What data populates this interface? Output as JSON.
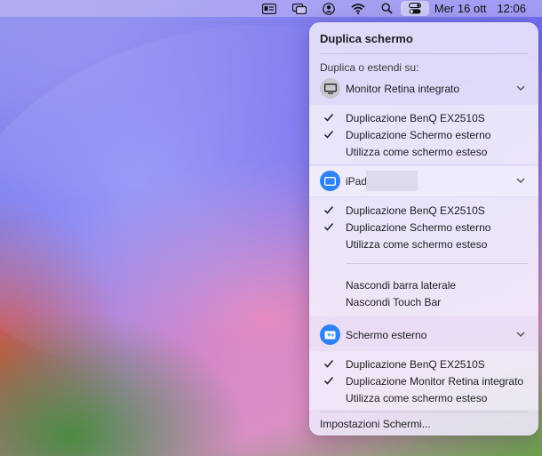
{
  "menubar": {
    "date": "Mer 16 ott",
    "time": "12:06",
    "icons": [
      "contacts-card-icon",
      "screen-mirroring-icon",
      "user-account-icon",
      "wifi-icon",
      "search-icon",
      "control-center-icon"
    ]
  },
  "panel": {
    "title": "Duplica schermo",
    "section_label": "Duplica o estendi su:",
    "devices": [
      {
        "name": "Monitor Retina integrato",
        "icon": "display-icon",
        "options": [
          {
            "label": "Duplicazione BenQ EX2510S",
            "checked": true
          },
          {
            "label": "Duplicazione Schermo esterno",
            "checked": true
          },
          {
            "label": "Utilizza come schermo esteso",
            "checked": false
          }
        ]
      },
      {
        "name": "iPad",
        "icon": "ipad-icon",
        "options": [
          {
            "label": "Duplicazione BenQ EX2510S",
            "checked": true
          },
          {
            "label": "Duplicazione Schermo esterno",
            "checked": true
          },
          {
            "label": "Utilizza come schermo esteso",
            "checked": false
          }
        ],
        "extra_options": [
          {
            "label": "Nascondi barra laterale"
          },
          {
            "label": "Nascondi Touch Bar"
          }
        ]
      },
      {
        "name": "Schermo esterno",
        "icon": "appletv-icon",
        "options": [
          {
            "label": "Duplicazione BenQ EX2510S",
            "checked": true
          },
          {
            "label": "Duplicazione Monitor Retina integrato",
            "checked": true
          },
          {
            "label": "Utilizza come schermo esteso",
            "checked": false
          }
        ]
      }
    ],
    "footer": "Impostazioni Schermi..."
  },
  "colors": {
    "accent_blue": "#2d82f6",
    "panel_bg": "#eee8fa"
  }
}
